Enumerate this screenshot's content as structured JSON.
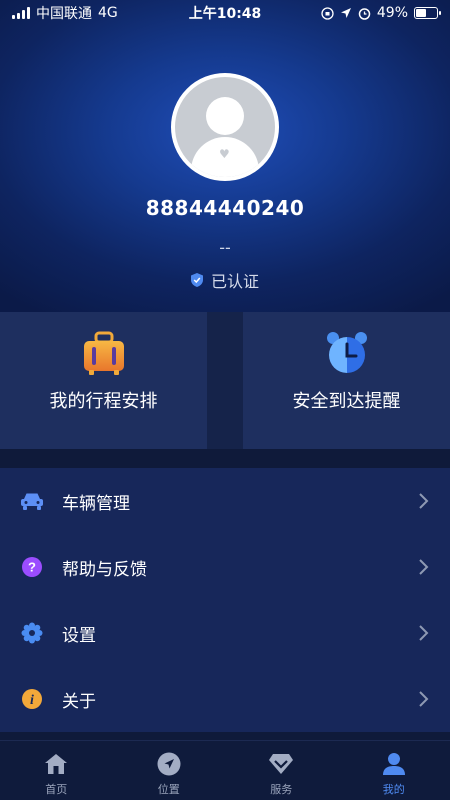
{
  "status_bar": {
    "carrier": "中国联通",
    "network": "4G",
    "time": "上午10:48",
    "battery": "49%",
    "battery_level": 0.49
  },
  "profile": {
    "phone": "88844440240",
    "nickname": "--",
    "verified_label": "已认证"
  },
  "cards": [
    {
      "label": "我的行程安排",
      "icon": "luggage-icon"
    },
    {
      "label": "安全到达提醒",
      "icon": "alarm-clock-icon"
    }
  ],
  "menu": [
    {
      "label": "车辆管理",
      "icon": "car-icon"
    },
    {
      "label": "帮助与反馈",
      "icon": "help-icon"
    },
    {
      "label": "设置",
      "icon": "settings-gear-icon"
    },
    {
      "label": "关于",
      "icon": "info-icon"
    }
  ],
  "tabs": [
    {
      "label": "首页",
      "icon": "home-icon"
    },
    {
      "label": "位置",
      "icon": "location-arrow-icon"
    },
    {
      "label": "服务",
      "icon": "diamond-icon"
    },
    {
      "label": "我的",
      "icon": "person-icon",
      "active": true
    }
  ],
  "colors": {
    "accent": "#4f8af0",
    "background": "#0f1a3a",
    "card": "#1e2f5f",
    "menu": "#17275a"
  }
}
